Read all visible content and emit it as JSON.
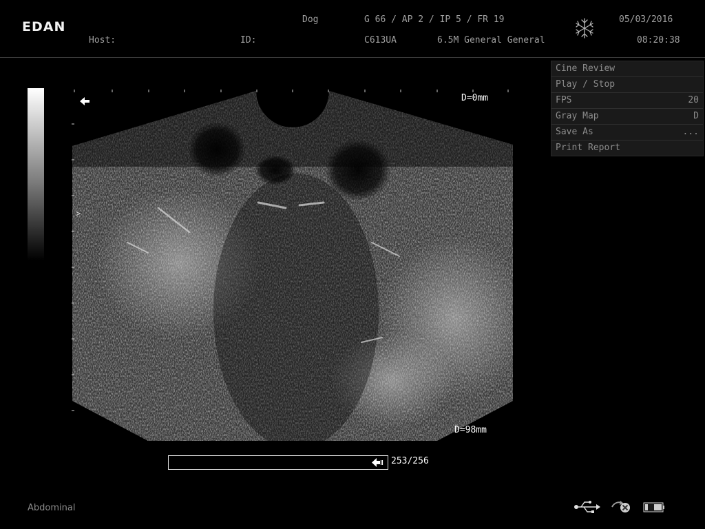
{
  "header": {
    "brand": "EDAN",
    "species": "Dog",
    "params": "G 66 / AP 2 / IP 5 / FR 19",
    "host_label": "Host:",
    "id_label": "ID:",
    "probe": "C613UA",
    "preset": "6.5M General General",
    "date": "05/03/2016",
    "time": "08:20:38",
    "freeze_icon": "snowflake-icon"
  },
  "menu": {
    "items": [
      {
        "label": "Cine Review",
        "value": ""
      },
      {
        "label": "Play / Stop",
        "value": ""
      },
      {
        "label": "FPS",
        "value": "20"
      },
      {
        "label": "Gray Map",
        "value": "D"
      },
      {
        "label": "Save As",
        "value": "..."
      },
      {
        "label": "Print Report",
        "value": ""
      }
    ]
  },
  "image": {
    "depth_top": "D=0mm",
    "depth_bottom": "D=98mm",
    "focus_marker": ">",
    "orientation_icon": "left-arrow-icon"
  },
  "cine": {
    "count": "253/256",
    "progress": 0.988
  },
  "footer": {
    "exam_type": "Abdominal",
    "icons": [
      "usb-icon",
      "network-disconnected-icon",
      "battery-icon"
    ]
  },
  "colors": {
    "background": "#000000",
    "text": "#9a9a9a",
    "menu_bg": "#1a1a1a",
    "highlight": "#ffffff"
  }
}
